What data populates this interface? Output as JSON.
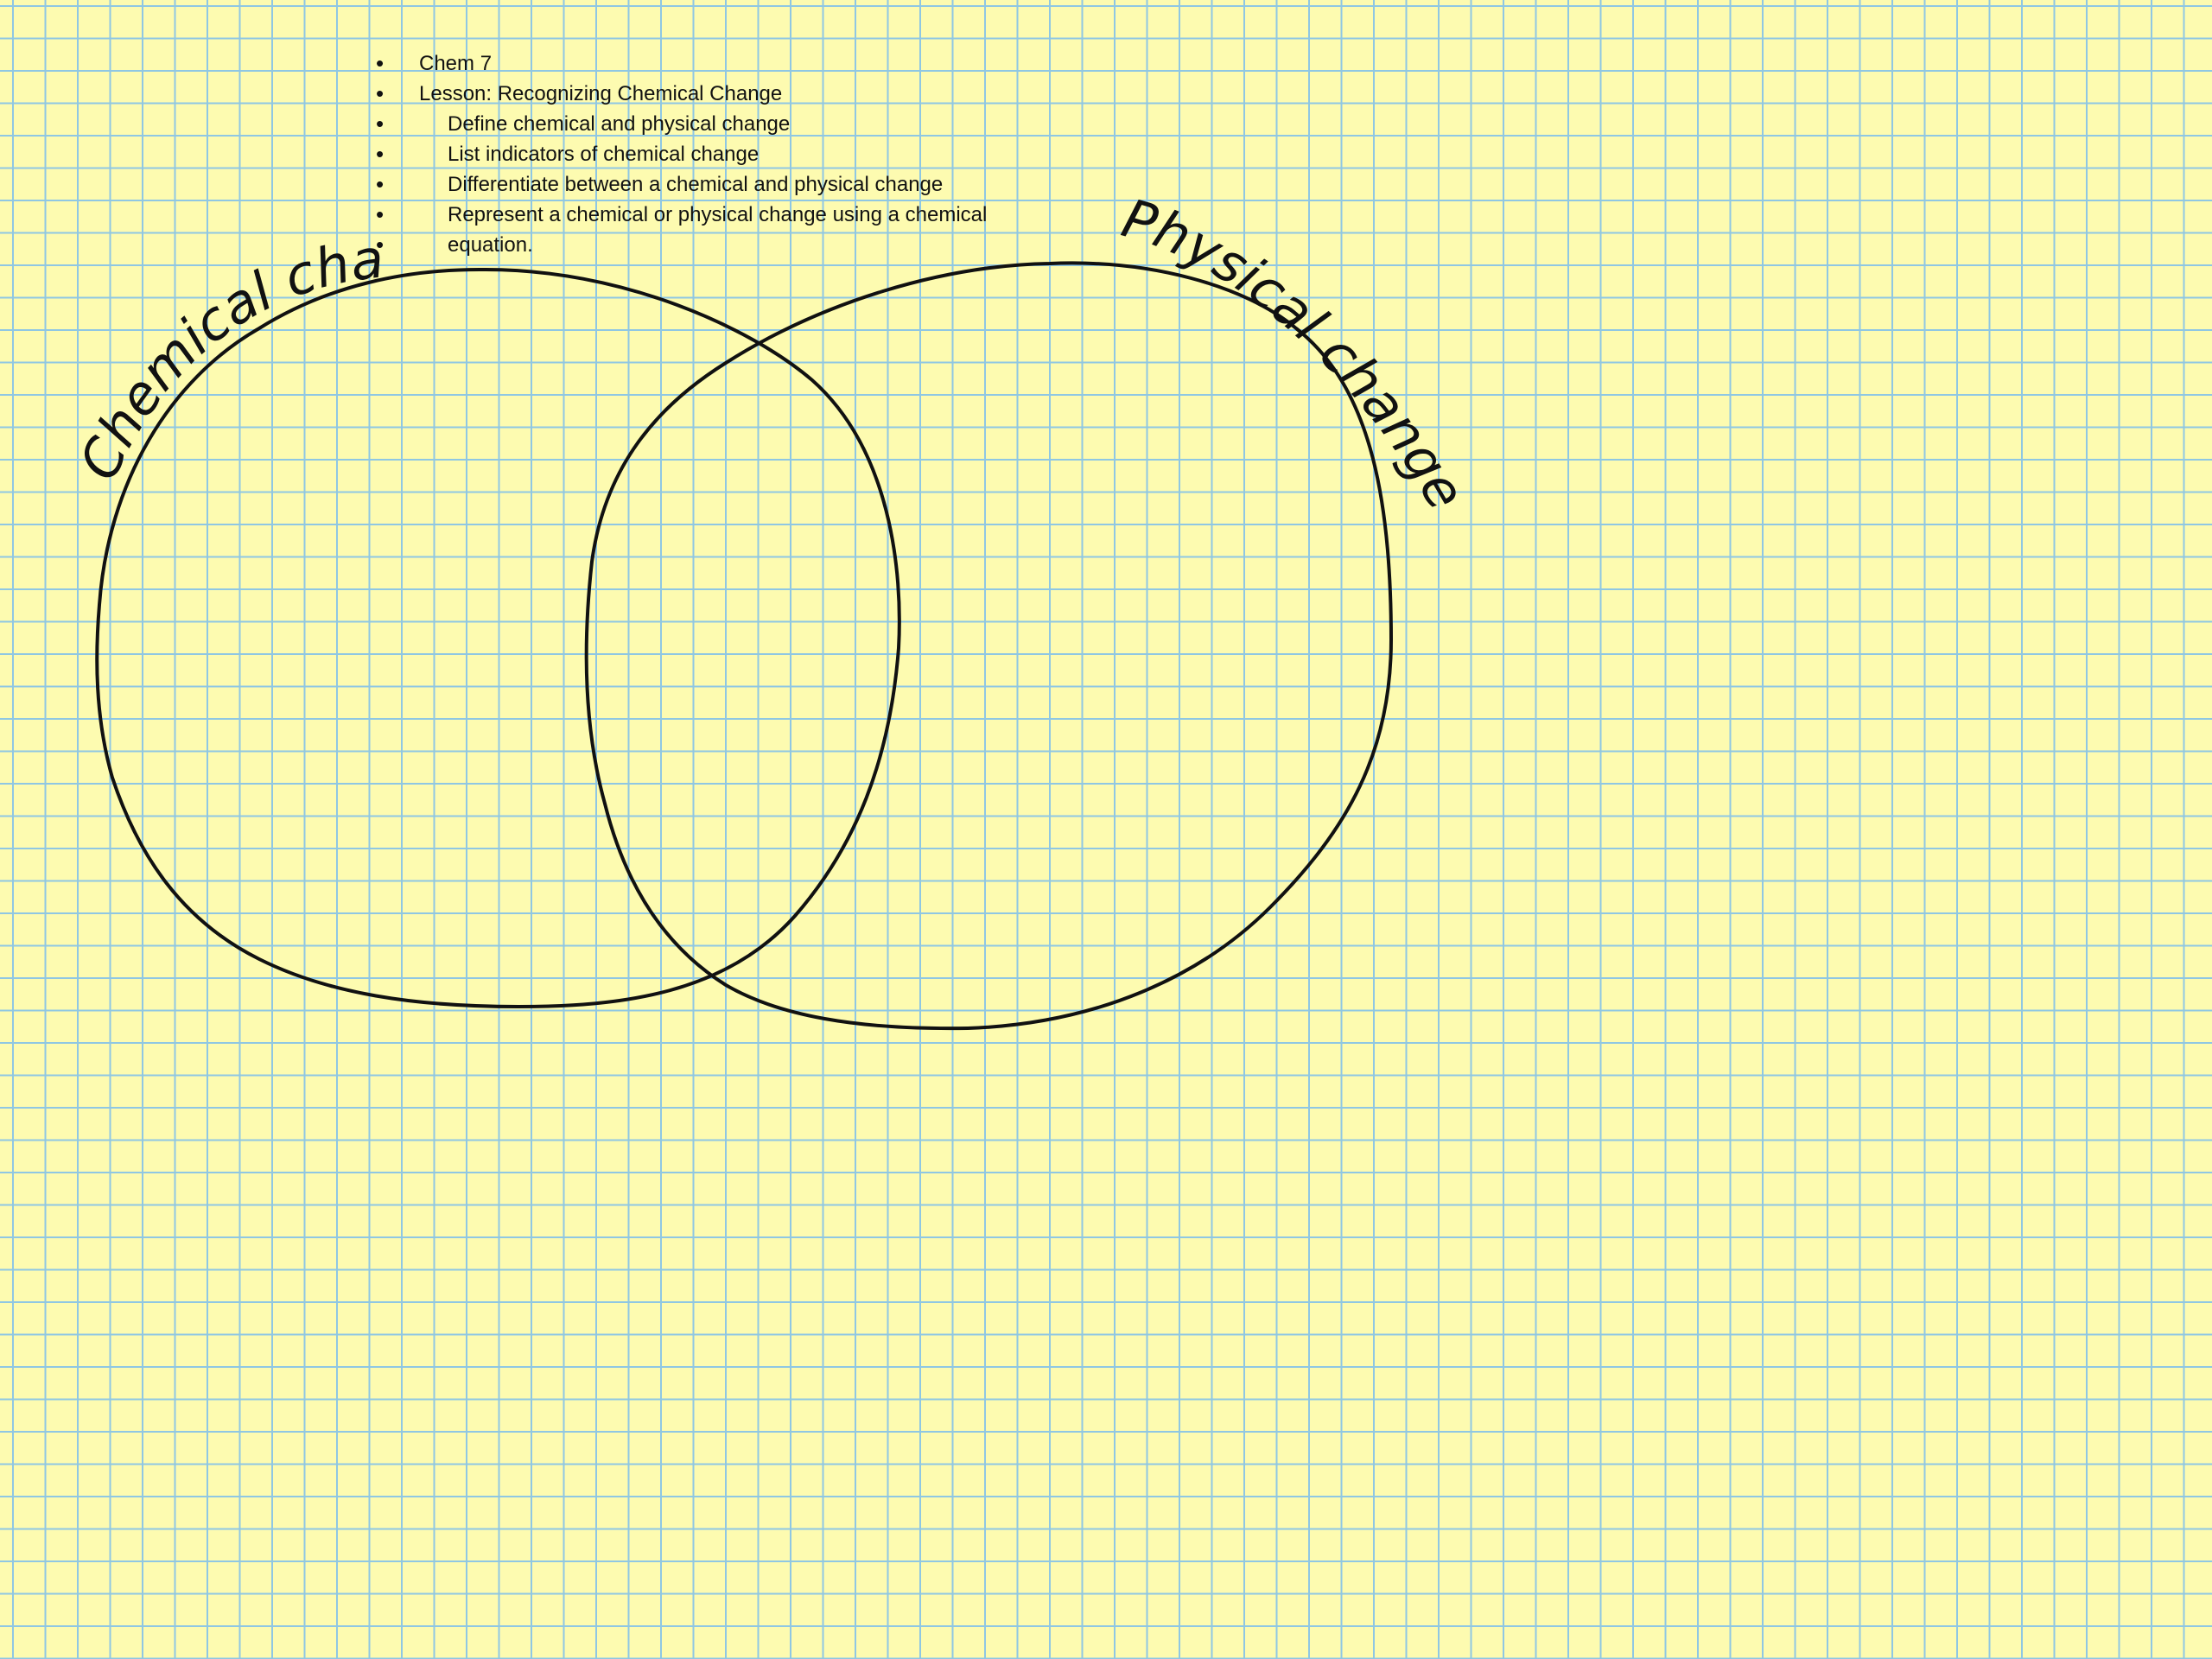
{
  "notes": {
    "items": [
      {
        "text": "Chem 7",
        "level": 1
      },
      {
        "text": "Lesson:  Recognizing Chemical Change",
        "level": 1
      },
      {
        "text": "Define chemical and physical change",
        "level": 2
      },
      {
        "text": "List indicators of chemical change",
        "level": 2
      },
      {
        "text": "Differentiate between a chemical and physical change",
        "level": 2
      },
      {
        "text": "Represent a chemical or physical change using a chemical",
        "level": 2
      },
      {
        "text": "equation.",
        "level": 2
      }
    ]
  },
  "venn": {
    "left_label": "Chemical change",
    "right_label": "Physical change"
  },
  "colors": {
    "paper": "#fdfbb0",
    "grid": "#8fc7e3",
    "ink": "#111111"
  }
}
